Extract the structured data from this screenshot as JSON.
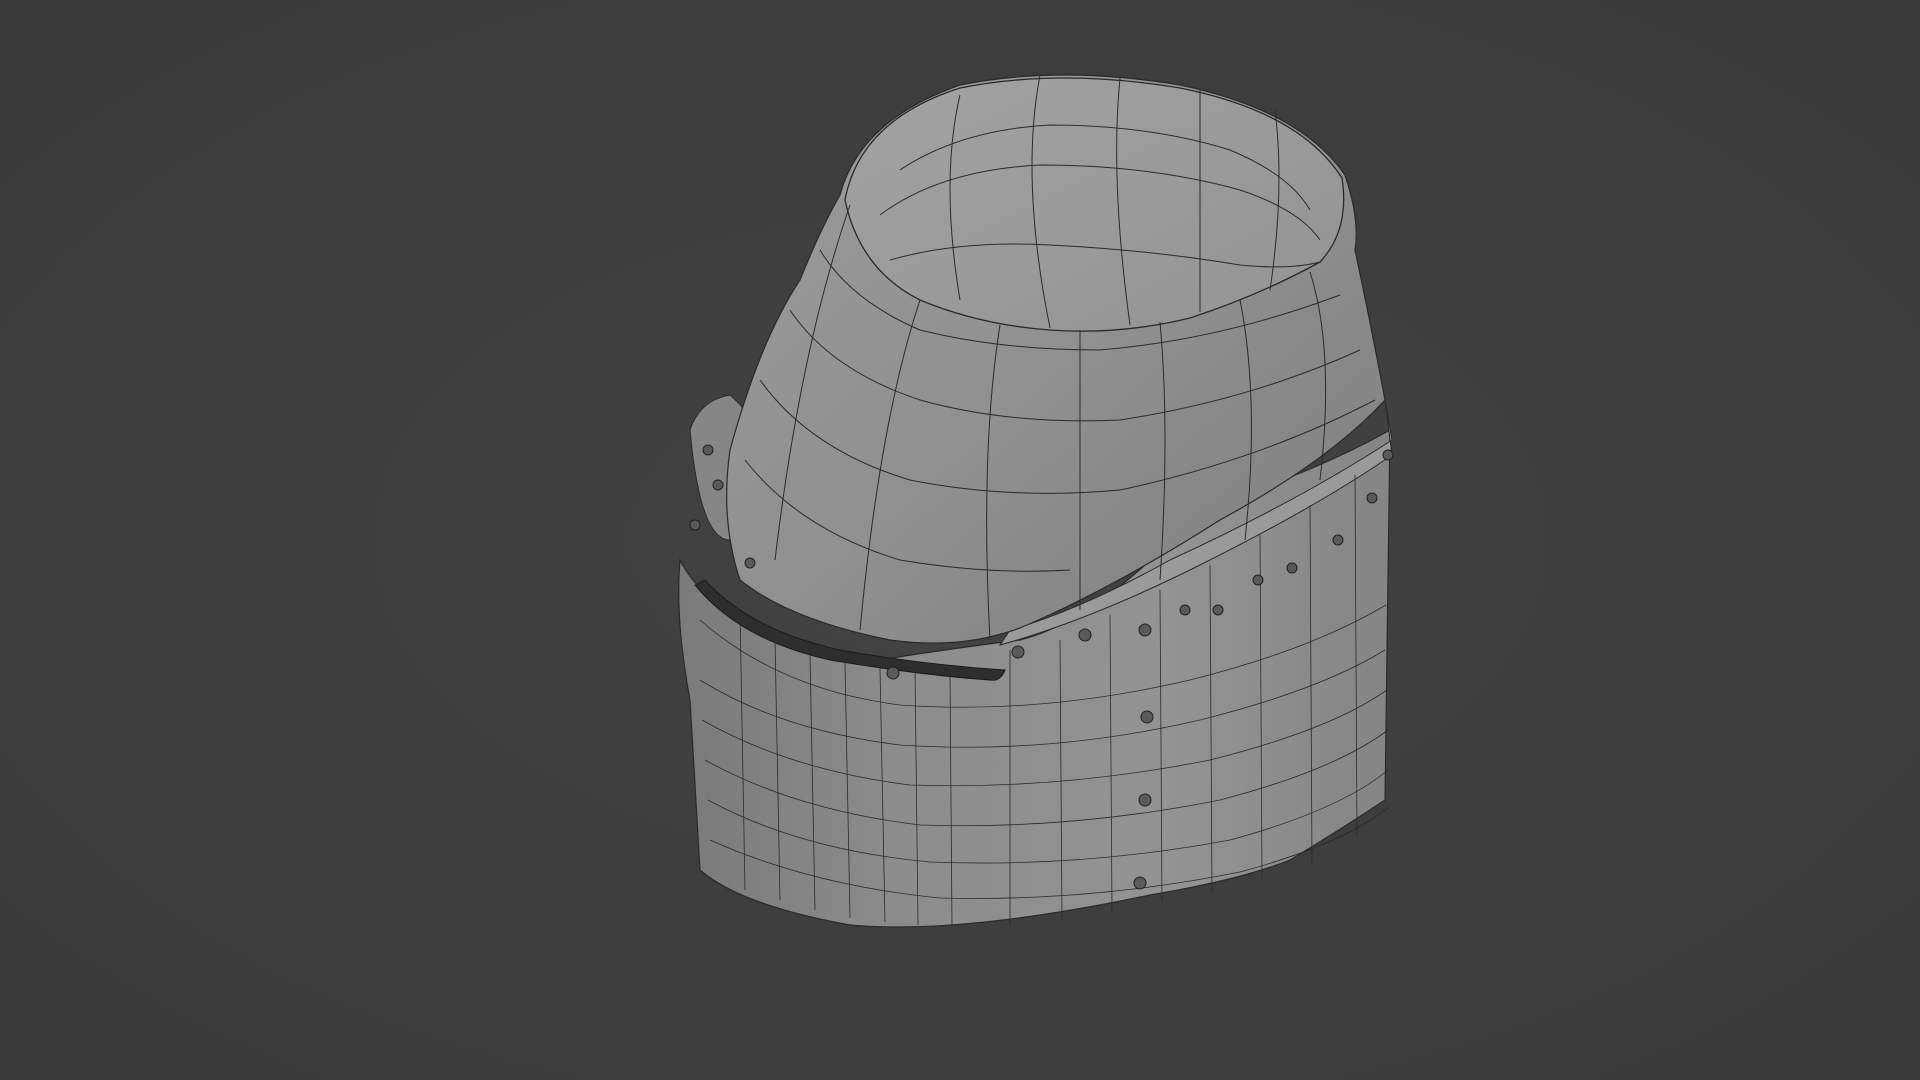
{
  "viewport": {
    "background": "#3d3d3d",
    "object": "great-helm",
    "shading": "solid-with-wireframe",
    "surface_color": "#8e8e8e",
    "edge_color": "#2a2a2a"
  }
}
